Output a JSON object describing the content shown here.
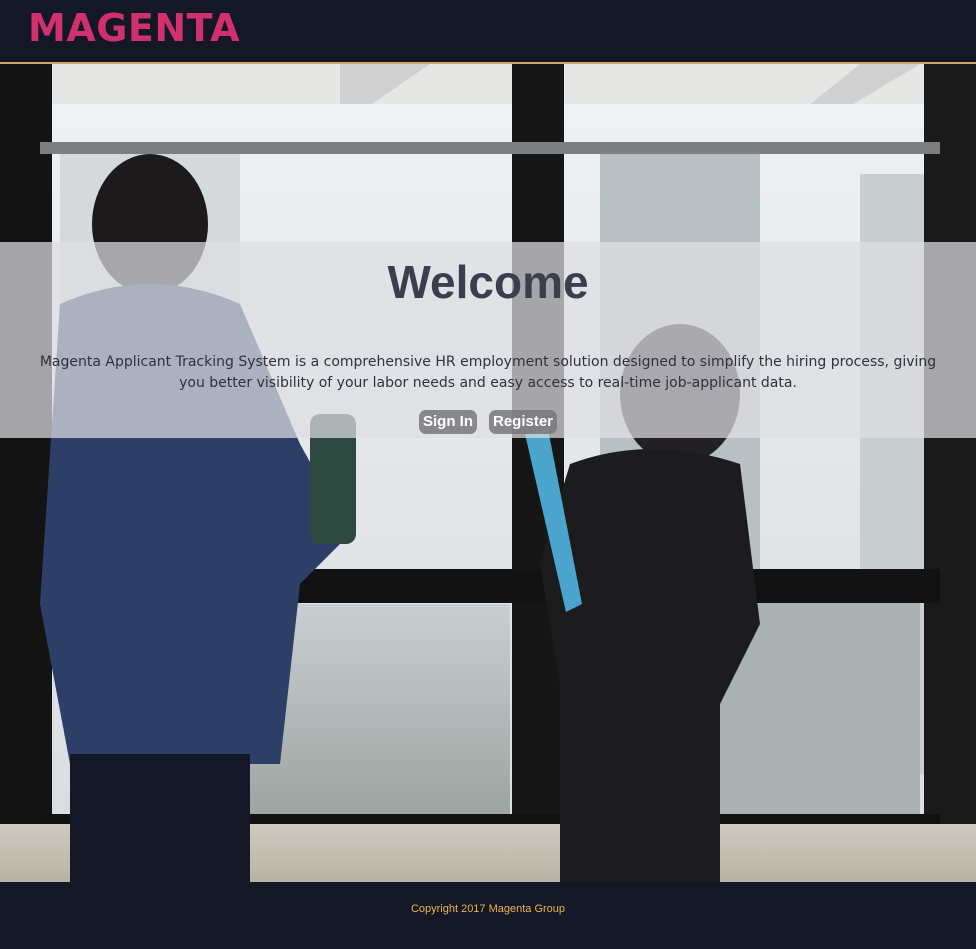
{
  "header": {
    "logo_text": "MAGENTA"
  },
  "hero": {
    "image_alt": "two-people-talking-by-office-window-photo",
    "title": "Welcome",
    "description": "Magenta Applicant Tracking System is a comprehensive HR employment solution designed to simplify the hiring process, giving you better visibility of your labor needs and easy access to real-time job-applicant data.",
    "sign_in_label": "Sign In",
    "register_label": "Register"
  },
  "footer": {
    "copyright": "Copyright 2017 Magenta Group"
  },
  "colors": {
    "brand": "#d0306d",
    "header_bg": "#131726",
    "header_border": "#c9a56a",
    "footer_text": "#e8b84a",
    "title_text": "#3b3e4e"
  }
}
